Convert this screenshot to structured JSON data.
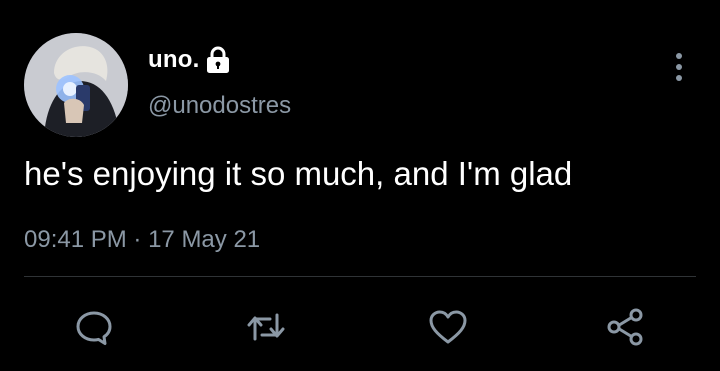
{
  "author": {
    "display_name": "uno.",
    "handle": "@unodostres",
    "protected": true
  },
  "tweet": {
    "text": "he's enjoying it so much, and I'm glad",
    "time": "09:41 PM",
    "separator": "·",
    "date": "17 May 21"
  },
  "icons": {
    "lock": "lock-icon",
    "more": "more-vertical-icon",
    "reply": "reply-icon",
    "retweet": "retweet-icon",
    "like": "heart-icon",
    "share": "share-icon"
  },
  "colors": {
    "background": "#000000",
    "primary_text": "#ffffff",
    "secondary_text": "#8b98a5",
    "divider": "#2f3336",
    "icon": "#8b98a5"
  }
}
